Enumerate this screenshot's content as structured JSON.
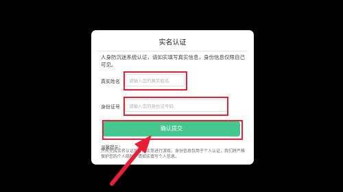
{
  "dialog": {
    "title": "实名认证",
    "notice": "人身防沉迷系统认证，请如实填写真实信息，身份信息仅限自己可见。",
    "name_label": "真实姓名",
    "name_placeholder": "请输入您的真实姓名",
    "id_label": "身份证号",
    "id_placeholder": "请输入您的身份证号码",
    "submit_label": "确认提交",
    "help_title": "温馨提示：",
    "help_text": "只有完成实名认证后才能正常进行游戏，身份信息仅用于个人认证，我们将严格保护您的个人隐私，请如实填写个人信息。"
  },
  "colors": {
    "highlight": "#ea1e34",
    "submit": "#43c98e",
    "background": "#000000"
  }
}
